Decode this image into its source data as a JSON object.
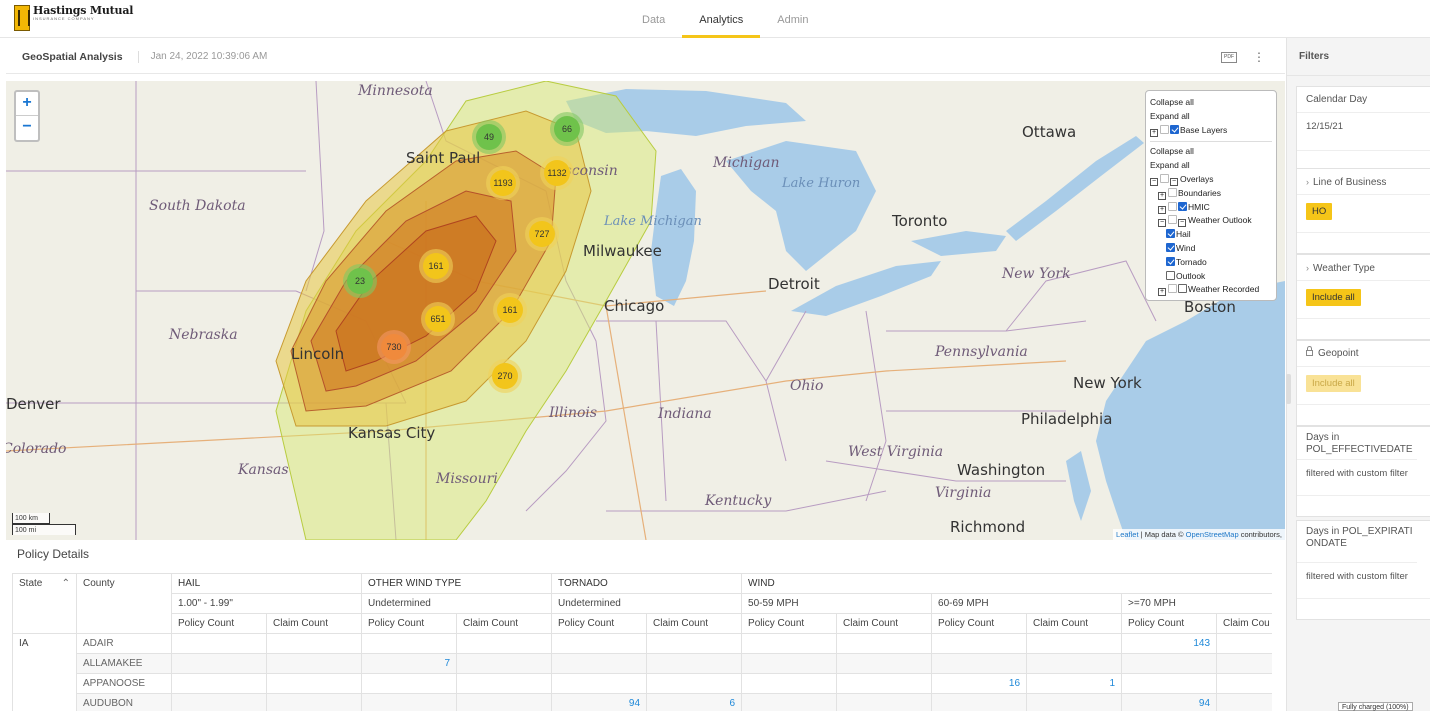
{
  "header": {
    "logo_name": "Hastings Mutual",
    "logo_sub": "INSURANCE COMPANY",
    "tabs": [
      {
        "label": "Data"
      },
      {
        "label": "Analytics"
      },
      {
        "label": "Admin"
      }
    ],
    "active_tab": "Analytics"
  },
  "report": {
    "title": "GeoSpatial Analysis",
    "timestamp": "Jan 24, 2022 10:39:06 AM",
    "pdf_label": "PDF",
    "more_icon": "vertical-dots-icon"
  },
  "map": {
    "zoom_in": "+",
    "zoom_out": "−",
    "states": [
      "Minnesota",
      "South Dakota",
      "Nebraska",
      "Kansas",
      "Missouri",
      "Illinois",
      "Indiana",
      "Ohio",
      "Kentucky",
      "West Virginia",
      "Virginia",
      "Pennsylvania",
      "New York",
      "Michigan",
      "Wisconsin"
    ],
    "water": [
      "Lake Huron",
      "Lake Michigan"
    ],
    "cities": [
      "Saint Paul",
      "Milwaukee",
      "Chicago",
      "Detroit",
      "Toronto",
      "Ottawa",
      "Boston",
      "New York",
      "Philadelphia",
      "Washington",
      "Richmond",
      "Lincoln",
      "Kansas City",
      "Denver",
      "Colorado"
    ],
    "clusters": [
      "49",
      "66",
      "1193",
      "1132",
      "727",
      "161",
      "23",
      "651",
      "161",
      "730",
      "270"
    ],
    "layers": {
      "collapse_all": "Collapse all",
      "expand_all": "Expand all",
      "base_layers": "Base Layers",
      "overlays": "Overlays",
      "boundaries": "Boundaries",
      "hmic": "HMIC",
      "weather_outlook": "Weather Outlook",
      "hail": "Hail",
      "wind": "Wind",
      "tornado": "Tornado",
      "outlook": "Outlook",
      "weather_recorded": "Weather Recorded"
    },
    "scale_km": "100 km",
    "scale_mi": "100 mi",
    "attribution_leaflet": "Leaflet",
    "attribution_text": "| Map data © ",
    "attribution_osm": "OpenStreetMap",
    "attribution_tail": " contributors,"
  },
  "policy": {
    "title": "Policy Details",
    "col_state": "State",
    "col_county": "County",
    "groups": [
      "HAIL",
      "OTHER WIND TYPE",
      "TORNADO",
      "WIND"
    ],
    "subgroups": [
      "1.00\" - 1.99\"",
      "Undetermined",
      "Undetermined",
      "50-59 MPH",
      "60-69 MPH",
      ">=70 MPH"
    ],
    "policy_count": "Policy Count",
    "claim_count": "Claim Count",
    "claim_count_cut": "Claim Cou",
    "rows": [
      {
        "state": "IA",
        "county": "ADAIR",
        "cells": [
          "",
          "",
          "",
          "",
          "",
          "",
          "",
          "",
          "",
          "",
          "143",
          ""
        ]
      },
      {
        "state": "",
        "county": "ALLAMAKEE",
        "cells": [
          "",
          "",
          "7",
          "",
          "",
          "",
          "",
          "",
          "",
          "",
          "",
          ""
        ]
      },
      {
        "state": "",
        "county": "APPANOOSE",
        "cells": [
          "",
          "",
          "",
          "",
          "",
          "",
          "",
          "",
          "16",
          "1",
          "",
          ""
        ]
      },
      {
        "state": "",
        "county": "AUDUBON",
        "cells": [
          "",
          "",
          "",
          "",
          "94",
          "6",
          "",
          "",
          "",
          "",
          "94",
          ""
        ]
      }
    ]
  },
  "filters": {
    "title": "Filters",
    "calendar_day": {
      "label": "Calendar Day",
      "value": "12/15/21"
    },
    "line_of_business": {
      "label": "Line of Business",
      "value": "HO"
    },
    "weather_type": {
      "label": "Weather Type",
      "value": "Include all"
    },
    "geopoint": {
      "label": "Geopoint",
      "value": "Include all"
    },
    "effective": {
      "label": "Days in POL_EFFECTIVEDATE",
      "value": "filtered with custom filter"
    },
    "expiration": {
      "label": "Days in POL_EXPIRATIONDATE",
      "value": "filtered with custom filter"
    }
  },
  "status_tip": "Fully charged (100%)",
  "colors": {
    "accent": "#f5c518",
    "link": "#1e88d8",
    "cluster_green": "#6fc24b",
    "cluster_yellow": "#f2c51b",
    "cluster_orange": "#f08a3c"
  }
}
